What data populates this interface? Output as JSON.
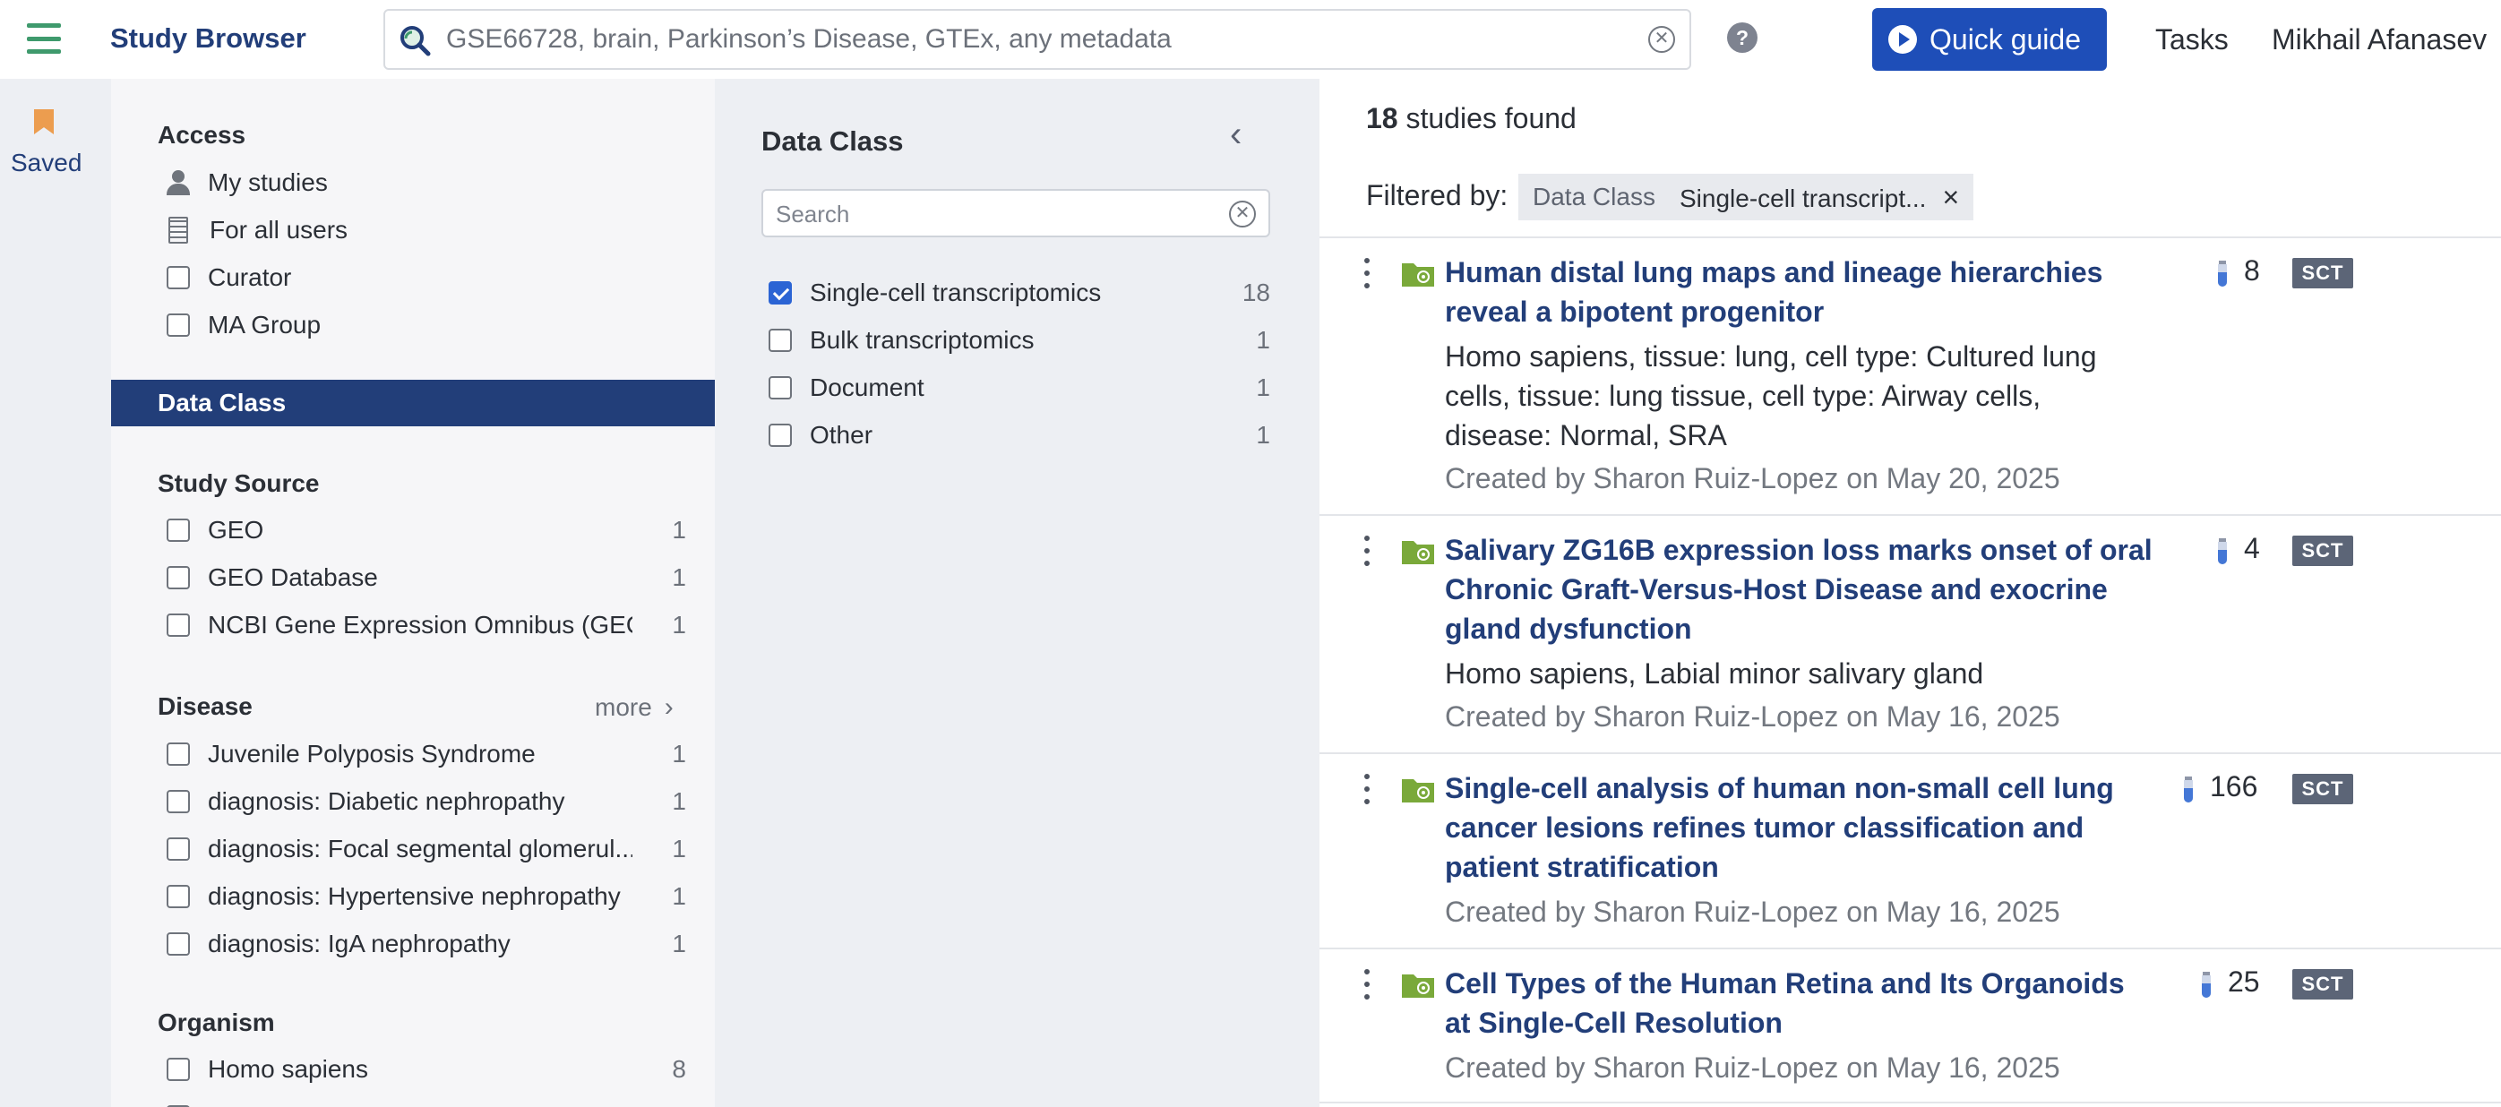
{
  "header": {
    "app_title": "Study Browser",
    "search_placeholder": "GSE66728, brain, Parkinson’s Disease, GTEx, any metadata",
    "quick_guide_label": "Quick guide",
    "tasks_label": "Tasks",
    "user_name": "Mikhail Afanasev"
  },
  "rail": {
    "saved_label": "Saved"
  },
  "filters": {
    "access": {
      "heading": "Access",
      "items": [
        {
          "label": "My studies",
          "icon": "person-icon"
        },
        {
          "label": "For all users",
          "icon": "building-icon"
        },
        {
          "label": "Curator",
          "checked": false
        },
        {
          "label": "MA Group",
          "checked": false
        }
      ]
    },
    "data_class_bar": "Data Class",
    "study_source": {
      "heading": "Study Source",
      "items": [
        {
          "label": "GEO",
          "count": "1"
        },
        {
          "label": "GEO Database",
          "count": "1"
        },
        {
          "label": "NCBI Gene Expression Omnibus (GEO)",
          "count": "1"
        }
      ]
    },
    "disease": {
      "heading": "Disease",
      "more_label": "more",
      "items": [
        {
          "label": "Juvenile Polyposis Syndrome",
          "count": "1"
        },
        {
          "label": "diagnosis: Diabetic nephropathy",
          "count": "1"
        },
        {
          "label": "diagnosis: Focal segmental glomerul...",
          "count": "1"
        },
        {
          "label": "diagnosis: Hypertensive nephropathy",
          "count": "1"
        },
        {
          "label": "diagnosis: IgA nephropathy",
          "count": "1"
        }
      ]
    },
    "organism": {
      "heading": "Organism",
      "items": [
        {
          "label": "Homo sapiens",
          "count": "8"
        }
      ]
    }
  },
  "data_class_panel": {
    "title": "Data Class",
    "search_placeholder": "Search",
    "options": [
      {
        "label": "Single-cell transcriptomics",
        "count": "18",
        "checked": true
      },
      {
        "label": "Bulk transcriptomics",
        "count": "1",
        "checked": false
      },
      {
        "label": "Document",
        "count": "1",
        "checked": false
      },
      {
        "label": "Other",
        "count": "1",
        "checked": false
      }
    ]
  },
  "results": {
    "count": "18",
    "count_suffix": " studies found",
    "filtered_by_label": "Filtered by:",
    "chip_key": "Data Class",
    "chip_value": "Single-cell transcript...",
    "chip_close": "×",
    "studies": [
      {
        "title": "Human distal lung maps and lineage hierarchies reveal a bipotent progenitor",
        "description": "Homo sapiens, tissue: lung, cell type: Cultured lung cells, tissue: lung tissue, cell type: Airway cells, disease: Normal, SRA",
        "created": "Created by Sharon Ruiz-Lopez on May 20, 2025",
        "samples": "8",
        "badge": "SCT"
      },
      {
        "title": "Salivary ZG16B expression loss marks onset of oral Chronic Graft-Versus-Host Disease and exocrine gland dysfunction",
        "description": "Homo sapiens, Labial minor salivary gland",
        "created": "Created by Sharon Ruiz-Lopez on May 16, 2025",
        "samples": "4",
        "badge": "SCT"
      },
      {
        "title": "Single-cell analysis of human non-small cell lung cancer lesions refines tumor classification and patient stratification",
        "description": "",
        "created": "Created by Sharon Ruiz-Lopez on May 16, 2025",
        "samples": "166",
        "badge": "SCT"
      },
      {
        "title": "Cell Types of the Human Retina and Its Organoids at Single-Cell Resolution",
        "description": "",
        "created": "Created by Sharon Ruiz-Lopez on May 16, 2025",
        "samples": "25",
        "badge": "SCT"
      }
    ]
  },
  "colors": {
    "brand_navy": "#223e79",
    "button_blue": "#1e4eb8",
    "accent_green": "#3f9a6d",
    "folder_green": "#7aa93a",
    "bookmark_orange": "#ec9d4f",
    "badge_gray": "#5c6577"
  }
}
